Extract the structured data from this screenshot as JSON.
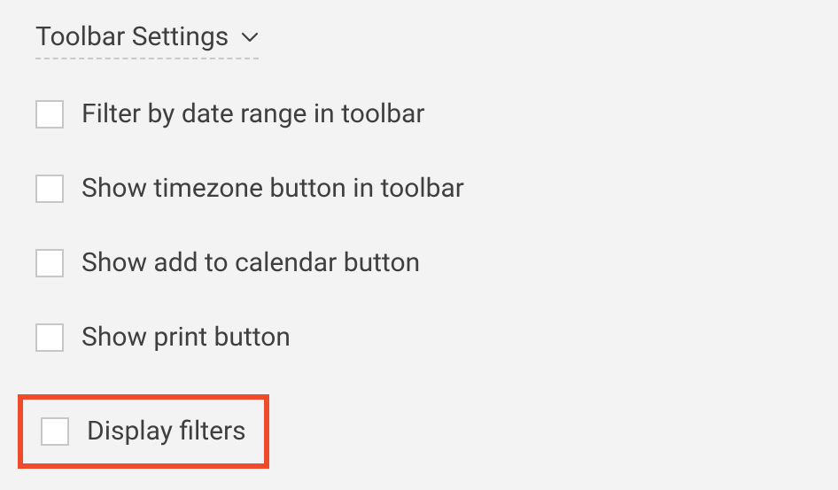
{
  "section": {
    "title": "Toolbar Settings",
    "options": [
      {
        "label": "Filter by date range in toolbar",
        "checked": false
      },
      {
        "label": "Show timezone button in toolbar",
        "checked": false
      },
      {
        "label": "Show add to calendar button",
        "checked": false
      },
      {
        "label": "Show print button",
        "checked": false
      },
      {
        "label": "Display filters",
        "checked": false,
        "highlighted": true
      }
    ]
  },
  "colors": {
    "highlight": "#ed4b2b"
  }
}
